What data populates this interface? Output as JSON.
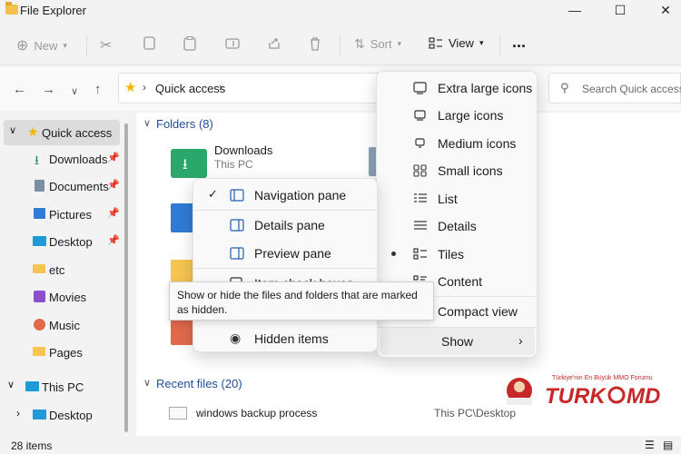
{
  "window": {
    "title": "File Explorer"
  },
  "toolbar": {
    "new_label": "New",
    "sort_label": "Sort",
    "view_label": "View",
    "more_label": "..."
  },
  "address": {
    "location": "Quick access"
  },
  "search": {
    "placeholder": "Search Quick access"
  },
  "sidebar": {
    "items": [
      {
        "label": "Quick access"
      },
      {
        "label": "Downloads"
      },
      {
        "label": "Documents"
      },
      {
        "label": "Pictures"
      },
      {
        "label": "Desktop"
      },
      {
        "label": "etc"
      },
      {
        "label": "Movies"
      },
      {
        "label": "Music"
      },
      {
        "label": "Pages"
      },
      {
        "label": "This PC"
      },
      {
        "label": "Desktop"
      }
    ]
  },
  "main": {
    "folders_header": "Folders (8)",
    "folder1_name": "Downloads",
    "folder1_sub": "This PC",
    "recent_header": "Recent files (20)",
    "recent_file_name": "windows backup process",
    "recent_file_path": "This PC\\Desktop"
  },
  "show_menu": {
    "items": [
      {
        "label": "Navigation pane",
        "checked": true
      },
      {
        "label": "Details pane"
      },
      {
        "label": "Preview pane"
      },
      {
        "label": "Item check boxes"
      },
      {
        "label": "Hidden items"
      }
    ]
  },
  "tooltip": {
    "text": "Show or hide the files and folders that are marked as hidden."
  },
  "view_menu": {
    "items": [
      {
        "label": "Extra large icons"
      },
      {
        "label": "Large icons"
      },
      {
        "label": "Medium icons"
      },
      {
        "label": "Small icons"
      },
      {
        "label": "List"
      },
      {
        "label": "Details"
      },
      {
        "label": "Tiles",
        "selected": true
      },
      {
        "label": "Content"
      },
      {
        "label": "Compact view"
      },
      {
        "label": "Show"
      }
    ]
  },
  "status": {
    "count": "28 items"
  },
  "watermark": {
    "brand": "TurkoMD",
    "tagline": "Türkiye'nin En Büyük MMO Forumu"
  }
}
